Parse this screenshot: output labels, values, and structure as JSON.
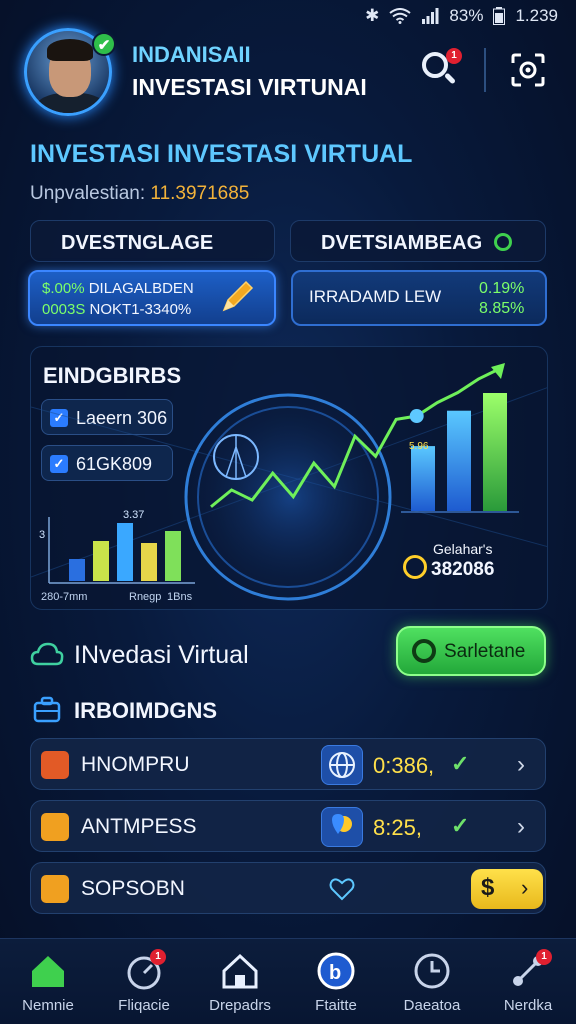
{
  "status": {
    "signal": "✱",
    "battery_pct": "83%",
    "time": "1.239"
  },
  "header": {
    "title_line1": "INDANISAII",
    "title_line2": "INVESTASI VIRTUNAI",
    "search_badge": "1",
    "verified_mark": "✔"
  },
  "hero": {
    "title": "INVESTASI INVESTASI VIRTUAL",
    "subtitle_label": "Unpvalestian:",
    "subtitle_value": "11.3971685"
  },
  "tabs": [
    {
      "label": "DVESTNGLAGE"
    },
    {
      "label": "DVETSIAMBEAG"
    }
  ],
  "stat_cards": [
    {
      "line1_pct": "$.00%",
      "line1_text": "DILAGALBDEN",
      "line2_pct": "0003S",
      "line2_text": "NOKT1-3340%"
    },
    {
      "label": "IRRADAMD LEW",
      "v1": "0.19%",
      "v2": "8.85%"
    }
  ],
  "chart_panel": {
    "heading": "EINDGBIRBS",
    "filters": [
      {
        "label": "Laeern 306",
        "checked": true
      },
      {
        "label": "61GK809",
        "checked": true
      }
    ],
    "small_chart_labels": {
      "top": "3.37",
      "left": "3",
      "x_labels": [
        "280-7mm",
        "Rnegp",
        "1Bns"
      ]
    },
    "right_bars_label": "5.96",
    "stat_caption": "Gelahar's",
    "stat_value": "382086"
  },
  "chart_data": [
    {
      "type": "line",
      "x": [
        1,
        2,
        3,
        4,
        5,
        6,
        7,
        8,
        9,
        10,
        11,
        12,
        13,
        14,
        15
      ],
      "series": [
        {
          "values": [
            18,
            28,
            22,
            38,
            24,
            44,
            30,
            60,
            48,
            70,
            72,
            80,
            86,
            94,
            100
          ]
        }
      ]
    },
    {
      "type": "bar",
      "categories": [
        "1",
        "2",
        "3",
        "4",
        "5"
      ],
      "series": [
        {
          "values": [
            22,
            40,
            58,
            38,
            50
          ]
        }
      ]
    },
    {
      "type": "bar",
      "categories": [
        "1",
        "2",
        "3"
      ],
      "series": [
        {
          "values": [
            55,
            85,
            100
          ]
        }
      ]
    }
  ],
  "action": {
    "title": "INvedasi Virtual",
    "button": "Sarletane"
  },
  "list": {
    "title": "IRBOIMDGNS",
    "items": [
      {
        "label": "HNOMPRU",
        "value": "0:386,",
        "chip_icon": "globe-icon"
      },
      {
        "label": "ANTMPESS",
        "value": "8:25,",
        "chip_icon": "map-pin-icon"
      },
      {
        "label": "SOPSOBN",
        "value": "",
        "chip_icon": "heart-icon",
        "cta": "$"
      }
    ]
  },
  "nav": [
    {
      "label": "Nemnie",
      "badge": ""
    },
    {
      "label": "Fliqacie",
      "badge": "1"
    },
    {
      "label": "Drepadrs",
      "badge": ""
    },
    {
      "label": "Ftaitte",
      "badge": ""
    },
    {
      "label": "Daeatoa",
      "badge": ""
    },
    {
      "label": "Nerdka",
      "badge": "1"
    }
  ],
  "colors": {
    "accent": "#3b86ff",
    "green": "#7cff6a",
    "yellow": "#ffe04a",
    "cyan": "#5ec8ff"
  }
}
